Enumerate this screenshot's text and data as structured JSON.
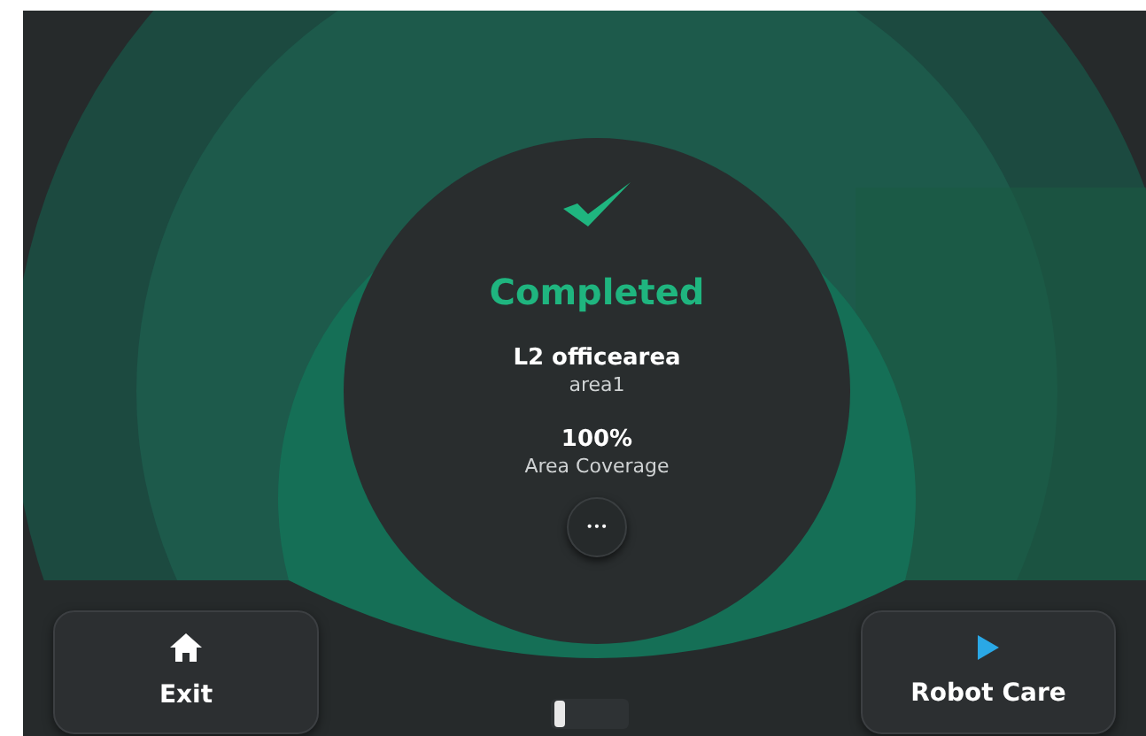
{
  "status": {
    "title": "Completed"
  },
  "map": {
    "name": "L2 officearea",
    "area": "area1"
  },
  "coverage": {
    "value": "100%",
    "label": "Area Coverage"
  },
  "more_button": {
    "label": "•••"
  },
  "buttons": [
    {
      "kind": "home",
      "label": "Exit"
    },
    {
      "kind": "play",
      "label": "Robot Care"
    }
  ]
}
